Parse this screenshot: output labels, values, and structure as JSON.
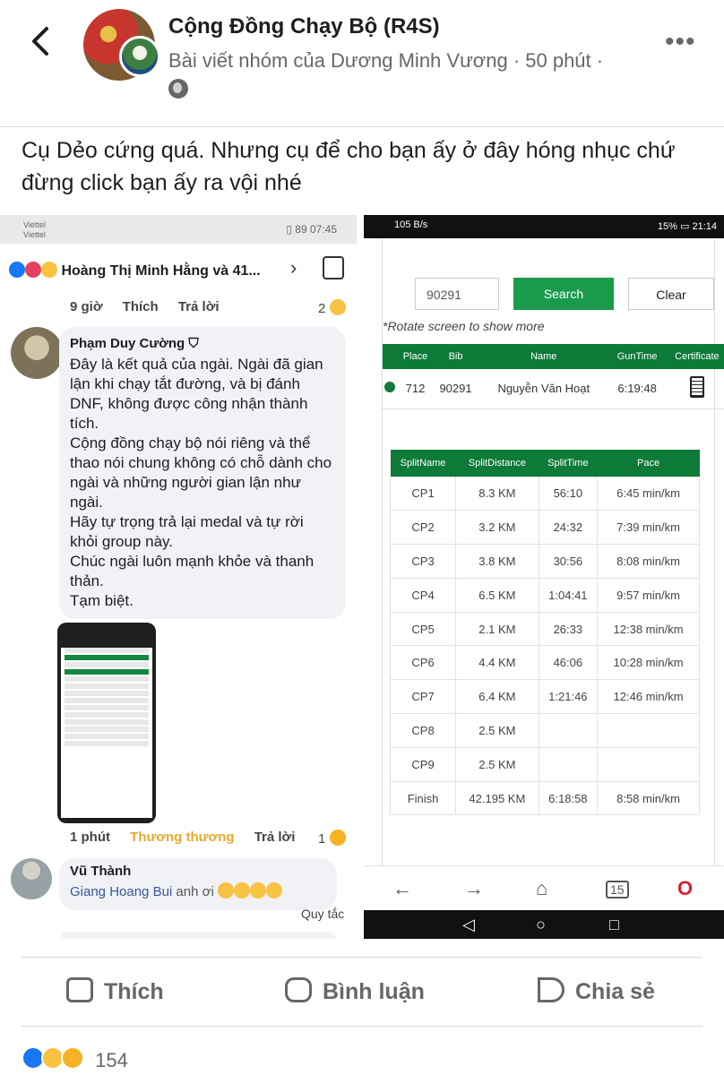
{
  "header": {
    "group_name": "Cộng Đồng Chạy Bộ (R4S)",
    "meta": "Bài viết nhóm của Dương Minh Vương · 50 phút ·",
    "more": "•••"
  },
  "post": {
    "text": "Cụ Dẻo cứng quá. Nhưng cụ để cho bạn ấy ở đây hóng nhục chứ đừng click bạn ấy ra vội nhé"
  },
  "left_screenshot": {
    "status": {
      "carrier": "Viettel\nViettel",
      "time": "07:45",
      "battery": "89"
    },
    "reactors": "Hoàng Thị Minh Hằng và 41...",
    "comment1_actions": {
      "time": "9 giờ",
      "like": "Thích",
      "reply": "Trả lời",
      "reacts": "2"
    },
    "comment1": {
      "name": "Phạm Duy Cường",
      "text": "Đây là kết quả của ngài. Ngài đã gian lận khi chạy tắt đường, và bị đánh DNF, không được công nhận thành tích.\nCộng đồng chạy bộ nói riêng và thể thao nói chung không có chỗ dành cho ngài và những người gian lận như ngài.\nHãy tự trọng trả lại medal và tự rời khỏi group này.\nChúc ngài luôn mạnh khỏe và thanh thản.\nTạm biệt."
    },
    "comment2_actions": {
      "time": "1 phút",
      "like": "Thương thương",
      "reply": "Trả lời",
      "reacts": "1"
    },
    "comment3": {
      "name": "Vũ Thành",
      "mention": "Giang Hoang Bui",
      "text": " anh ơi"
    },
    "rules_link": "Quy tắc"
  },
  "right_screenshot": {
    "status": {
      "time": "21:14",
      "battery": "15%",
      "speed": "105 B/s"
    },
    "search": {
      "bib_value": "90291",
      "search_label": "Search",
      "clear_label": "Clear"
    },
    "note": "*Rotate screen to show more",
    "result_headers": [
      "Place",
      "Bib",
      "Name",
      "GunTime",
      "Certificate"
    ],
    "result_row": {
      "place": "712",
      "bib": "90291",
      "name": "Nguyễn Văn Hoạt",
      "guntime": "6:19:48"
    },
    "split_headers": [
      "SplitName",
      "SplitDistance",
      "SplitTime",
      "Pace"
    ],
    "splits": [
      [
        "CP1",
        "8.3 KM",
        "56:10",
        "6:45 min/km"
      ],
      [
        "CP2",
        "3.2 KM",
        "24:32",
        "7:39 min/km"
      ],
      [
        "CP3",
        "3.8 KM",
        "30:56",
        "8:08 min/km"
      ],
      [
        "CP4",
        "6.5 KM",
        "1:04:41",
        "9:57 min/km"
      ],
      [
        "CP5",
        "2.1 KM",
        "26:33",
        "12:38 min/km"
      ],
      [
        "CP6",
        "4.4 KM",
        "46:06",
        "10:28 min/km"
      ],
      [
        "CP7",
        "6.4 KM",
        "1:21:46",
        "12:46 min/km"
      ],
      [
        "CP8",
        "2.5 KM",
        "",
        ""
      ],
      [
        "CP9",
        "2.5 KM",
        "",
        ""
      ],
      [
        "Finish",
        "42.195 KM",
        "6:18:58",
        "8:58 min/km"
      ]
    ],
    "tab_count": "15"
  },
  "actions": {
    "like": "Thích",
    "comment": "Bình luận",
    "share": "Chia sẻ"
  },
  "reaction_count": "154",
  "colors": {
    "fb_grey": "#65676b",
    "green": "#0e7a38",
    "search_green": "#1a9b4b",
    "like_blue": "#1877f2"
  }
}
